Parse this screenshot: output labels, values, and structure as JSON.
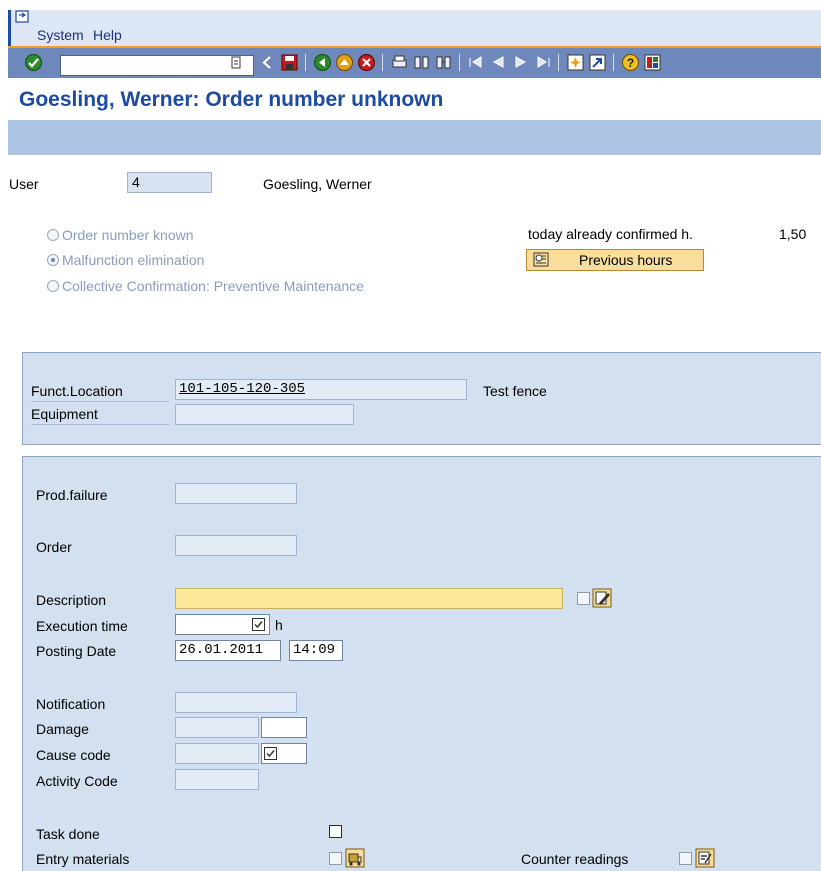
{
  "menu": {
    "items": [
      "System",
      "Help"
    ]
  },
  "toolbar": {
    "command_field_value": "",
    "buttons": [
      "enter",
      "back-arrow",
      "save",
      "back",
      "exit",
      "cancel",
      "print",
      "find",
      "find-next",
      "first-page",
      "previous-page",
      "next-page",
      "last-page",
      "create-session",
      "shortcut",
      "help",
      "customize-layout"
    ]
  },
  "title": "Goesling, Werner: Order number unknown",
  "user": {
    "label": "User",
    "id": "4",
    "name": "Goesling, Werner"
  },
  "mode": {
    "options": [
      {
        "label": "Order number known",
        "selected": false
      },
      {
        "label": "Malfunction elimination",
        "selected": true
      },
      {
        "label": "Collective Confirmation: Preventive Maintenance",
        "selected": false
      }
    ]
  },
  "confirmed": {
    "label": "today already confirmed h.",
    "value": "1,50"
  },
  "previous_hours_button": "Previous hours",
  "location": {
    "funct_location_label": "Funct.Location",
    "funct_location_value": "101-105-120-305",
    "funct_location_desc": "Test fence",
    "equipment_label": "Equipment",
    "equipment_value": ""
  },
  "form": {
    "prod_failure_label": "Prod.failure",
    "prod_failure_value": "",
    "order_label": "Order",
    "order_value": "",
    "description_label": "Description",
    "description_value": "",
    "execution_time_label": "Execution time",
    "execution_time_value": "",
    "execution_time_unit": "h",
    "posting_date_label": "Posting Date",
    "posting_date_value": "26.01.2011",
    "posting_time_value": "14:09",
    "notification_label": "Notification",
    "notification_value": "",
    "damage_label": "Damage",
    "cause_code_label": "Cause code",
    "activity_code_label": "Activity Code",
    "task_done_label": "Task done",
    "entry_materials_label": "Entry materials",
    "counter_readings_label": "Counter readings"
  },
  "colors": {
    "title": "#1d4aa3",
    "toolbar": "#6e88bb",
    "group_bg": "#d3e0ef",
    "required_field": "#fde89a"
  }
}
